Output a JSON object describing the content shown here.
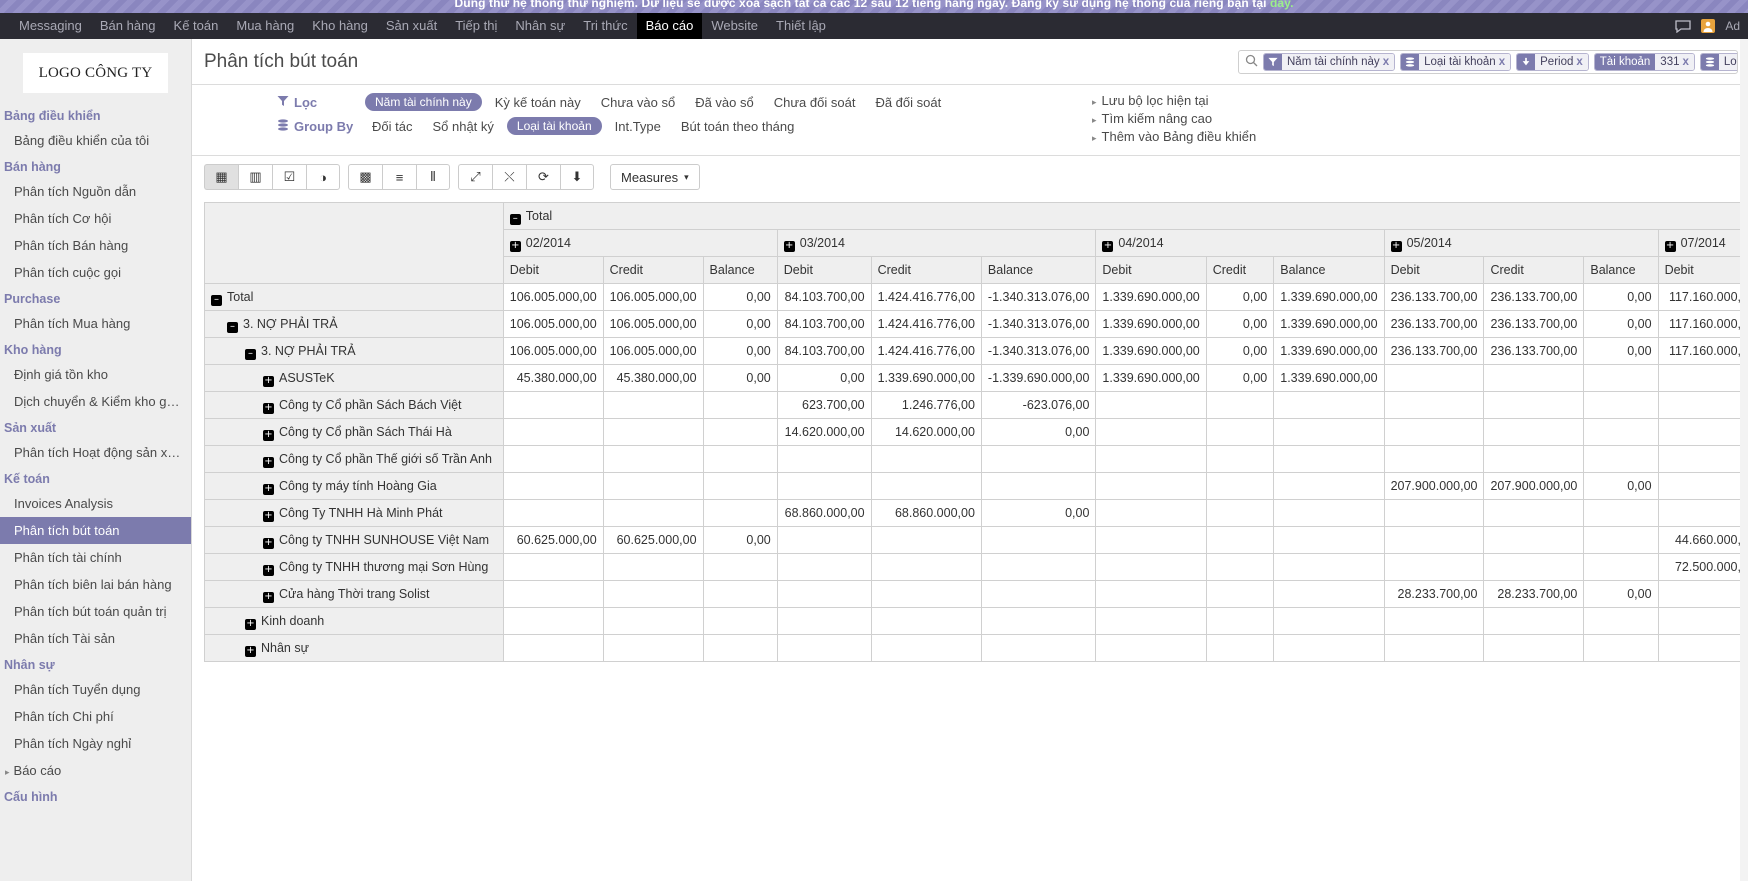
{
  "promo": {
    "text": "Dùng thử hệ thống thử nghiệm. Dữ liệu sẽ được xóa sạch tất cả các 12 sau 12 tiếng hàng ngày. Đăng ký sử dụng hệ thống của riêng bạn tại ",
    "link": "đây."
  },
  "topnav": {
    "items": [
      {
        "label": "Messaging",
        "active": false
      },
      {
        "label": "Bán hàng",
        "active": false
      },
      {
        "label": "Kế toán",
        "active": false
      },
      {
        "label": "Mua hàng",
        "active": false
      },
      {
        "label": "Kho hàng",
        "active": false
      },
      {
        "label": "Sản xuất",
        "active": false
      },
      {
        "label": "Tiếp thị",
        "active": false
      },
      {
        "label": "Nhân sự",
        "active": false
      },
      {
        "label": "Tri thức",
        "active": false
      },
      {
        "label": "Báo cáo",
        "active": true
      },
      {
        "label": "Website",
        "active": false
      },
      {
        "label": "Thiết lập",
        "active": false
      }
    ],
    "chat_icon": "chat-icon",
    "user_icon": "user-avatar-icon",
    "username": "Ad"
  },
  "sidebar": {
    "logo": "LOGO CÔNG TY",
    "groups": [
      {
        "title": "Bảng điều khiển",
        "items": [
          {
            "label": "Bảng điều khiển của tôi",
            "active": false,
            "caret": false
          }
        ]
      },
      {
        "title": "Bán hàng",
        "items": [
          {
            "label": "Phân tích Nguồn dẫn",
            "active": false,
            "caret": false
          },
          {
            "label": "Phân tích Cơ hội",
            "active": false,
            "caret": false
          },
          {
            "label": "Phân tích Bán hàng",
            "active": false,
            "caret": false
          },
          {
            "label": "Phân tích cuộc gọi",
            "active": false,
            "caret": false
          }
        ]
      },
      {
        "title": "Purchase",
        "items": [
          {
            "label": "Phân tích Mua hàng",
            "active": false,
            "caret": false
          }
        ]
      },
      {
        "title": "Kho hàng",
        "items": [
          {
            "label": "Định giá tồn kho",
            "active": false,
            "caret": false
          },
          {
            "label": "Dịch chuyển & Kiểm kho g…",
            "active": false,
            "caret": false
          }
        ]
      },
      {
        "title": "Sản xuất",
        "items": [
          {
            "label": "Phân tích Hoạt động sản x…",
            "active": false,
            "caret": false
          }
        ]
      },
      {
        "title": "Kế toán",
        "items": [
          {
            "label": "Invoices Analysis",
            "active": false,
            "caret": false
          },
          {
            "label": "Phân tích bút toán",
            "active": true,
            "caret": false
          },
          {
            "label": "Phân tích tài chính",
            "active": false,
            "caret": false
          },
          {
            "label": "Phân tích biên lai bán hàng",
            "active": false,
            "caret": false
          },
          {
            "label": "Phân tích bút toán quản trị",
            "active": false,
            "caret": false
          },
          {
            "label": "Phân tích Tài sản",
            "active": false,
            "caret": false
          }
        ]
      },
      {
        "title": "Nhân sự",
        "items": [
          {
            "label": "Phân tích Tuyển dụng",
            "active": false,
            "caret": false
          },
          {
            "label": "Phân tích Chi phí",
            "active": false,
            "caret": false
          },
          {
            "label": "Phân tích Ngày nghỉ",
            "active": false,
            "caret": false
          },
          {
            "label": "Báo cáo",
            "active": false,
            "caret": true
          }
        ]
      },
      {
        "title": "Cấu hình",
        "items": []
      }
    ]
  },
  "page": {
    "title": "Phân tích bút toán"
  },
  "search": {
    "icon": "search-icon",
    "facets": [
      {
        "icon": "filter-icon",
        "label": "Năm tài chính này",
        "value": "",
        "x": "x"
      },
      {
        "icon": "groupby-icon",
        "label": "Loại tài khoản",
        "value": "",
        "x": "x"
      },
      {
        "icon": "arrow-down-icon",
        "label": "Period",
        "value": "",
        "x": "x"
      },
      {
        "icon": "",
        "label": "Tài khoản",
        "value": "331",
        "x": "x"
      },
      {
        "icon": "groupby-icon",
        "label": "Loại tài khoản",
        "value": "",
        "x": "x"
      }
    ]
  },
  "filter_panel": {
    "filter_label": "Lọc",
    "filter_icon": "filter-icon",
    "filter_options": [
      {
        "label": "Năm tài chính này",
        "selected": true
      },
      {
        "label": "Kỳ kế toán này",
        "selected": false
      },
      {
        "label": "Chưa vào sổ",
        "selected": false
      },
      {
        "label": "Đã vào sổ",
        "selected": false
      },
      {
        "label": "Chưa đối soát",
        "selected": false
      },
      {
        "label": "Đã đối soát",
        "selected": false
      }
    ],
    "groupby_label": "Group By",
    "groupby_icon": "groupby-icon",
    "groupby_options": [
      {
        "label": "Đối tác",
        "selected": false
      },
      {
        "label": "Sổ nhật ký",
        "selected": false
      },
      {
        "label": "Loại tài khoản",
        "selected": true
      },
      {
        "label": "Int.Type",
        "selected": false
      },
      {
        "label": "Bút toán theo tháng",
        "selected": false
      }
    ],
    "links": [
      "Lưu bộ lọc hiện tại",
      "Tìm kiếm nâng cao",
      "Thêm vào Bảng điều khiển"
    ]
  },
  "toolbar": {
    "groups": [
      [
        {
          "name": "pivot-view-icon",
          "glyph": "▦",
          "active": true
        },
        {
          "name": "bar-chart-icon",
          "glyph": "▥",
          "active": false
        },
        {
          "name": "line-chart-icon",
          "glyph": "☑",
          "active": false
        },
        {
          "name": "pie-chart-icon",
          "glyph": "◑",
          "active": false
        }
      ],
      [
        {
          "name": "grid-icon",
          "glyph": "▩",
          "active": false
        },
        {
          "name": "list-icon",
          "glyph": "≡",
          "active": false
        },
        {
          "name": "columns-icon",
          "glyph": "⦀",
          "active": false
        }
      ],
      [
        {
          "name": "expand-icon",
          "glyph": "⤢",
          "active": false
        },
        {
          "name": "collapse-icon",
          "glyph": "⤬",
          "active": false
        },
        {
          "name": "refresh-icon",
          "glyph": "⟳",
          "active": false
        },
        {
          "name": "download-icon",
          "glyph": "⬇",
          "active": false
        }
      ]
    ],
    "measures_label": "Measures",
    "measures_caret": "▾"
  },
  "pivot": {
    "total_header": "Total",
    "total_icon": "minus-box-icon",
    "column_groups": [
      {
        "label": "02/2014",
        "icon": "plus-box-icon",
        "cols": [
          "Debit",
          "Credit",
          "Balance"
        ]
      },
      {
        "label": "03/2014",
        "icon": "plus-box-icon",
        "cols": [
          "Debit",
          "Credit",
          "Balance"
        ]
      },
      {
        "label": "04/2014",
        "icon": "plus-box-icon",
        "cols": [
          "Debit",
          "Credit",
          "Balance"
        ]
      },
      {
        "label": "05/2014",
        "icon": "plus-box-icon",
        "cols": [
          "Debit",
          "Credit",
          "Balance"
        ]
      },
      {
        "label": "07/2014",
        "icon": "plus-box-icon",
        "cols": [
          "Debit"
        ]
      }
    ],
    "rows": [
      {
        "label": "Total",
        "icon": "minus",
        "indent": 0,
        "values": [
          "106.005.000,00",
          "106.005.000,00",
          "0,00",
          "84.103.700,00",
          "1.424.416.776,00",
          "-1.340.313.076,00",
          "1.339.690.000,00",
          "0,00",
          "1.339.690.000,00",
          "236.133.700,00",
          "236.133.700,00",
          "0,00",
          "117.160.000,"
        ]
      },
      {
        "label": "3. NỢ PHẢI TRẢ",
        "icon": "minus",
        "indent": 1,
        "values": [
          "106.005.000,00",
          "106.005.000,00",
          "0,00",
          "84.103.700,00",
          "1.424.416.776,00",
          "-1.340.313.076,00",
          "1.339.690.000,00",
          "0,00",
          "1.339.690.000,00",
          "236.133.700,00",
          "236.133.700,00",
          "0,00",
          "117.160.000,"
        ]
      },
      {
        "label": "3. NỢ PHẢI TRẢ",
        "icon": "minus",
        "indent": 2,
        "values": [
          "106.005.000,00",
          "106.005.000,00",
          "0,00",
          "84.103.700,00",
          "1.424.416.776,00",
          "-1.340.313.076,00",
          "1.339.690.000,00",
          "0,00",
          "1.339.690.000,00",
          "236.133.700,00",
          "236.133.700,00",
          "0,00",
          "117.160.000,"
        ]
      },
      {
        "label": "ASUSTeK",
        "icon": "plus",
        "indent": 3,
        "values": [
          "45.380.000,00",
          "45.380.000,00",
          "0,00",
          "0,00",
          "1.339.690.000,00",
          "-1.339.690.000,00",
          "1.339.690.000,00",
          "0,00",
          "1.339.690.000,00",
          "",
          "",
          "",
          ""
        ]
      },
      {
        "label": "Công ty Cổ phần Sách Bách Việt",
        "icon": "plus",
        "indent": 3,
        "values": [
          "",
          "",
          "",
          "623.700,00",
          "1.246.776,00",
          "-623.076,00",
          "",
          "",
          "",
          "",
          "",
          "",
          ""
        ]
      },
      {
        "label": "Công ty Cổ phần Sách Thái Hà",
        "icon": "plus",
        "indent": 3,
        "values": [
          "",
          "",
          "",
          "14.620.000,00",
          "14.620.000,00",
          "0,00",
          "",
          "",
          "",
          "",
          "",
          "",
          ""
        ]
      },
      {
        "label": "Công ty Cổ phần Thế giới số Trần Anh",
        "icon": "plus",
        "indent": 3,
        "values": [
          "",
          "",
          "",
          "",
          "",
          "",
          "",
          "",
          "",
          "",
          "",
          "",
          ""
        ]
      },
      {
        "label": "Công ty máy tính Hoàng Gia",
        "icon": "plus",
        "indent": 3,
        "values": [
          "",
          "",
          "",
          "",
          "",
          "",
          "",
          "",
          "",
          "207.900.000,00",
          "207.900.000,00",
          "0,00",
          ""
        ]
      },
      {
        "label": "Công Ty TNHH Hà Minh Phát",
        "icon": "plus",
        "indent": 3,
        "values": [
          "",
          "",
          "",
          "68.860.000,00",
          "68.860.000,00",
          "0,00",
          "",
          "",
          "",
          "",
          "",
          "",
          ""
        ]
      },
      {
        "label": "Công ty TNHH SUNHOUSE Việt Nam",
        "icon": "plus",
        "indent": 3,
        "values": [
          "60.625.000,00",
          "60.625.000,00",
          "0,00",
          "",
          "",
          "",
          "",
          "",
          "",
          "",
          "",
          "",
          "44.660.000,"
        ]
      },
      {
        "label": "Công ty TNHH thương mại Sơn Hùng",
        "icon": "plus",
        "indent": 3,
        "values": [
          "",
          "",
          "",
          "",
          "",
          "",
          "",
          "",
          "",
          "",
          "",
          "",
          "72.500.000,"
        ]
      },
      {
        "label": "Cửa hàng Thời trang Solist",
        "icon": "plus",
        "indent": 3,
        "values": [
          "",
          "",
          "",
          "",
          "",
          "",
          "",
          "",
          "",
          "28.233.700,00",
          "28.233.700,00",
          "0,00",
          ""
        ]
      },
      {
        "label": "Kinh doanh",
        "icon": "plus",
        "indent": 2,
        "values": [
          "",
          "",
          "",
          "",
          "",
          "",
          "",
          "",
          "",
          "",
          "",
          "",
          ""
        ]
      },
      {
        "label": "Nhân sự",
        "icon": "plus",
        "indent": 2,
        "values": [
          "",
          "",
          "",
          "",
          "",
          "",
          "",
          "",
          "",
          "",
          "",
          "",
          ""
        ]
      }
    ]
  },
  "colors": {
    "accent": "#7c7bad",
    "topbar": "#2b2b33",
    "sidebar_bg": "#eeeeee",
    "header_cell": "#efefef"
  }
}
